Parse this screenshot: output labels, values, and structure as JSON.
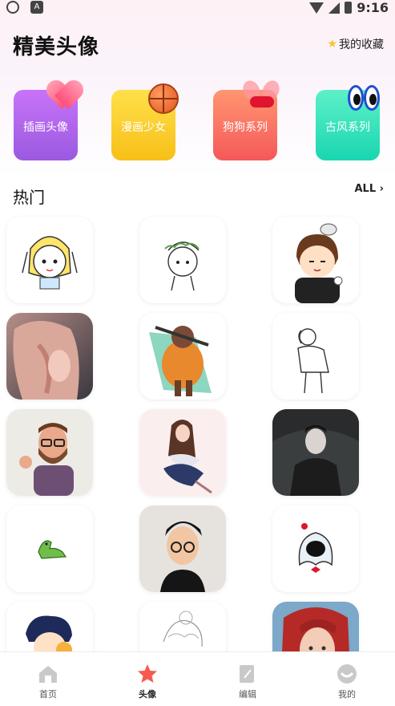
{
  "status_bar": {
    "time": "9:16"
  },
  "header": {
    "title": "精美头像",
    "favorites_label": "我的收藏",
    "favorites_icon": "star-icon"
  },
  "categories": [
    {
      "label": "插画头像",
      "icon": "heart-icon"
    },
    {
      "label": "漫画少女",
      "icon": "basketball-icon"
    },
    {
      "label": "狗狗系列",
      "icon": "bow-icon"
    },
    {
      "label": "古风系列",
      "icon": "cartoon-eyes-icon"
    }
  ],
  "hot_section": {
    "title": "热门",
    "all_label": "ALL"
  },
  "avatars": [
    "girl-sketch-avatar",
    "boy-sketch-avatar",
    "boy-cat-avatar",
    "anime-girl-avatar",
    "armored-brute-avatar",
    "lineart-man-avatar",
    "bearded-man-avatar",
    "sitting-girl-avatar",
    "man-umbrella-photo",
    "dinosaur-avatar",
    "glasses-man-avatar",
    "ghost-cat-avatar",
    "curly-boy-avatar",
    "sketch-portrait-avatar",
    "redhead-girl-avatar"
  ],
  "bottom_nav": [
    {
      "label": "首页",
      "icon": "home-icon",
      "active": false
    },
    {
      "label": "头像",
      "icon": "star-icon",
      "active": true
    },
    {
      "label": "编辑",
      "icon": "edit-icon",
      "active": false
    },
    {
      "label": "我的",
      "icon": "profile-icon",
      "active": false
    }
  ],
  "colors": {
    "accent": "#f65a4f",
    "nav_inactive": "#c9c9c9"
  }
}
